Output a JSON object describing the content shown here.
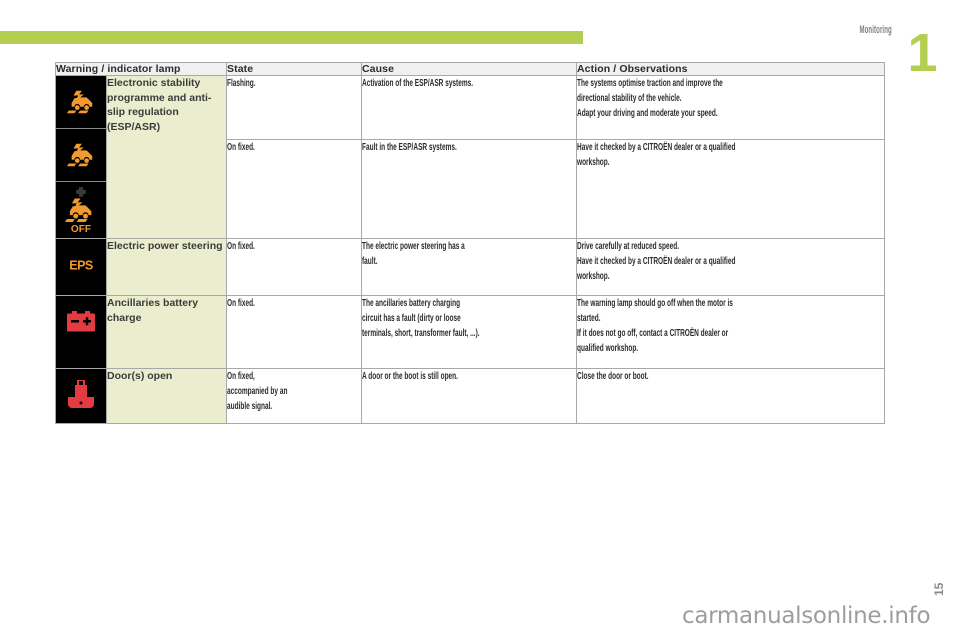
{
  "header": {
    "chapter_title": "Monitoring",
    "chapter_number": "1",
    "accent_color": "#b4ce51"
  },
  "table": {
    "columns": [
      {
        "key": "lamp",
        "label": "Warning / indicator lamp"
      },
      {
        "key": "state",
        "label": "State"
      },
      {
        "key": "cause",
        "label": "Cause"
      },
      {
        "key": "action",
        "label": "Action / Observations"
      }
    ],
    "rows": [
      {
        "id": "esp-asr",
        "label": "Electronic stability programme and anti-slip regulation (ESP/ASR)",
        "icons": [
          "esp-skid-car-icon",
          "esp-skid-car-icon",
          "esp-off-icon"
        ],
        "icon_color": "#f09a30",
        "sub_rows": [
          {
            "state": "Flashing.",
            "cause": "Activation of the ESP/ASR systems.",
            "action_lines": [
              "The systems optimise traction and improve the",
              "directional stability of the vehicle.",
              "Adapt your driving and moderate your speed."
            ]
          },
          {
            "state": "On fixed.",
            "cause": "Fault in the ESP/ASR systems.",
            "action_lines": [
              "Have it checked by a CITROËN dealer or a qualified",
              "workshop."
            ]
          }
        ]
      },
      {
        "id": "electric-power-steering",
        "label": "Electric power steering",
        "icons": [
          "eps-icon"
        ],
        "icon_color": "#f09a30",
        "sub_rows": [
          {
            "state": "On fixed.",
            "cause_lines": [
              "The electric power steering has a",
              "fault."
            ],
            "action_lines": [
              "Drive carefully at reduced speed.",
              "Have it checked by a CITROËN dealer or a qualified",
              "workshop."
            ]
          }
        ]
      },
      {
        "id": "ancillaries-battery-charge",
        "label": "Ancillaries battery charge",
        "icons": [
          "battery-icon"
        ],
        "icon_color": "#e43b42",
        "sub_rows": [
          {
            "state": "On fixed.",
            "cause_lines": [
              "The ancillaries battery charging",
              "circuit has a fault (dirty or loose",
              "terminals, short, transformer fault, ...)."
            ],
            "action_lines": [
              "The warning lamp should go off when the motor is",
              "started.",
              "If it does not go off, contact a CITROËN dealer or",
              "qualified workshop."
            ]
          }
        ]
      },
      {
        "id": "doors-open",
        "label": "Door(s) open",
        "icons": [
          "door-open-icon"
        ],
        "icon_color": "#e43b42",
        "sub_rows": [
          {
            "state_lines": [
              "On fixed,",
              "accompanied by an",
              "audible signal."
            ],
            "cause": "A door or the boot is still open.",
            "action_lines": [
              "Close the door or boot."
            ]
          }
        ]
      }
    ]
  },
  "footer": {
    "watermark": "carmanualsonline.info",
    "page_number": "15"
  }
}
